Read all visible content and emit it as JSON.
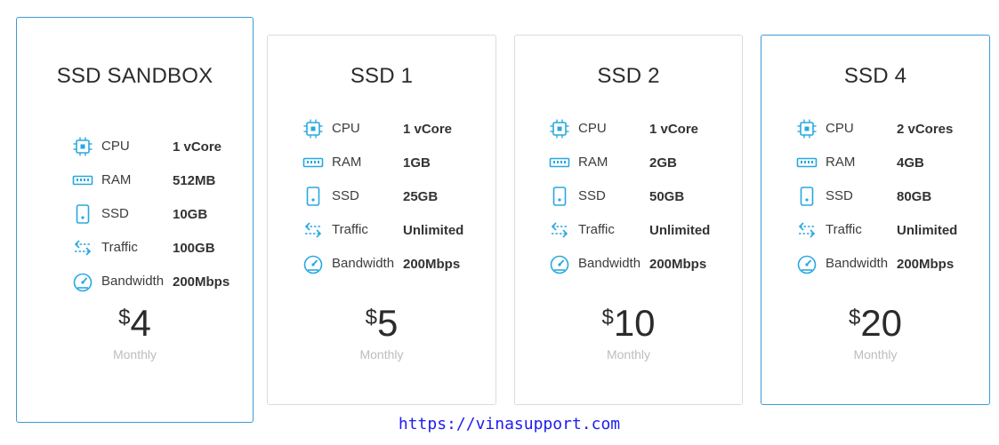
{
  "accent_color": "#29a8e0",
  "plans": [
    {
      "title": "SSD SANDBOX",
      "featured": true,
      "specs": [
        {
          "icon": "cpu-icon",
          "label": "CPU",
          "value": "1 vCore"
        },
        {
          "icon": "ram-icon",
          "label": "RAM",
          "value": "512MB"
        },
        {
          "icon": "ssd-icon",
          "label": "SSD",
          "value": "10GB"
        },
        {
          "icon": "traffic-icon",
          "label": "Traffic",
          "value": "100GB"
        },
        {
          "icon": "bandwidth-icon",
          "label": "Bandwidth",
          "value": "200Mbps"
        }
      ],
      "currency": "$",
      "price": "4",
      "period": "Monthly"
    },
    {
      "title": "SSD 1",
      "featured": false,
      "specs": [
        {
          "icon": "cpu-icon",
          "label": "CPU",
          "value": "1 vCore"
        },
        {
          "icon": "ram-icon",
          "label": "RAM",
          "value": "1GB"
        },
        {
          "icon": "ssd-icon",
          "label": "SSD",
          "value": "25GB"
        },
        {
          "icon": "traffic-icon",
          "label": "Traffic",
          "value": "Unlimited"
        },
        {
          "icon": "bandwidth-icon",
          "label": "Bandwidth",
          "value": "200Mbps"
        }
      ],
      "currency": "$",
      "price": "5",
      "period": "Monthly"
    },
    {
      "title": "SSD 2",
      "featured": false,
      "specs": [
        {
          "icon": "cpu-icon",
          "label": "CPU",
          "value": "1 vCore"
        },
        {
          "icon": "ram-icon",
          "label": "RAM",
          "value": "2GB"
        },
        {
          "icon": "ssd-icon",
          "label": "SSD",
          "value": "50GB"
        },
        {
          "icon": "traffic-icon",
          "label": "Traffic",
          "value": "Unlimited"
        },
        {
          "icon": "bandwidth-icon",
          "label": "Bandwidth",
          "value": "200Mbps"
        }
      ],
      "currency": "$",
      "price": "10",
      "period": "Monthly"
    },
    {
      "title": "SSD 4",
      "featured": true,
      "specs": [
        {
          "icon": "cpu-icon",
          "label": "CPU",
          "value": "2 vCores"
        },
        {
          "icon": "ram-icon",
          "label": "RAM",
          "value": "4GB"
        },
        {
          "icon": "ssd-icon",
          "label": "SSD",
          "value": "80GB"
        },
        {
          "icon": "traffic-icon",
          "label": "Traffic",
          "value": "Unlimited"
        },
        {
          "icon": "bandwidth-icon",
          "label": "Bandwidth",
          "value": "200Mbps"
        }
      ],
      "currency": "$",
      "price": "20",
      "period": "Monthly"
    }
  ],
  "footer": {
    "link_text": "https://vinasupport.com"
  }
}
